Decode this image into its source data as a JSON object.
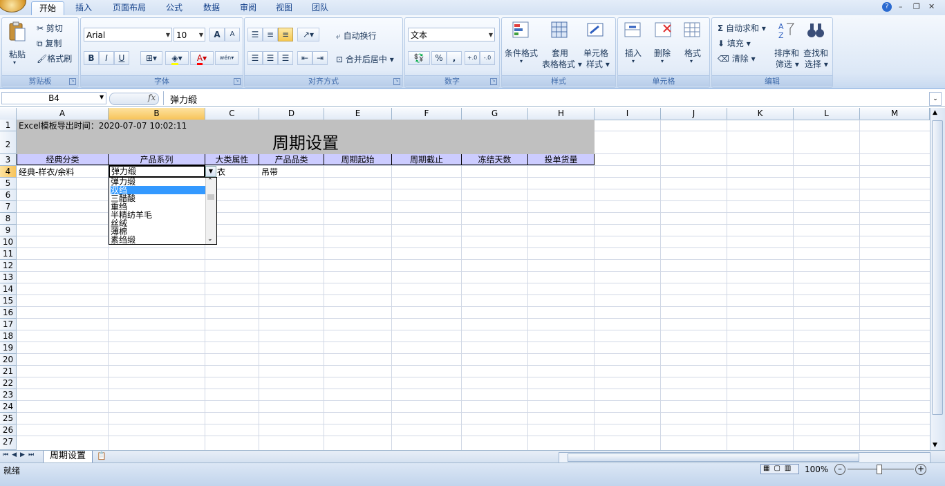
{
  "tabs": [
    "开始",
    "插入",
    "页面布局",
    "公式",
    "数据",
    "审阅",
    "视图",
    "团队"
  ],
  "active_tab": "开始",
  "clipboard": {
    "paste": "粘贴",
    "cut": "剪切",
    "copy": "复制",
    "format_painter": "格式刷",
    "label": "剪贴板"
  },
  "font": {
    "name": "Arial",
    "size": "10",
    "label": "字体",
    "grow": "A",
    "shrink": "A",
    "bold": "B",
    "italic": "I",
    "underline": "U",
    "font_color": "A",
    "phonetic": "wén"
  },
  "alignment": {
    "wrap": "自动换行",
    "merge": "合并后居中",
    "label": "对齐方式"
  },
  "number": {
    "format": "文本",
    "percent": "%",
    "comma": ",",
    "inc_dec": "+.0",
    "dec_dec": "-.0",
    "label": "数字"
  },
  "styles": {
    "conditional": "条件格式",
    "table1": "套用",
    "table2": "表格格式",
    "cell1": "单元格",
    "cell2": "样式",
    "label": "样式"
  },
  "cells": {
    "insert": "插入",
    "delete": "删除",
    "format": "格式",
    "label": "单元格"
  },
  "editing": {
    "autosum": "自动求和",
    "fill": "填充",
    "clear": "清除",
    "sort1": "排序和",
    "sort2": "筛选",
    "find1": "查找和",
    "find2": "选择",
    "label": "编辑"
  },
  "formula_bar": {
    "name_box": "B4",
    "fx": "fx",
    "value": "弹力缎"
  },
  "columns": [
    "A",
    "B",
    "C",
    "D",
    "E",
    "F",
    "G",
    "H",
    "I",
    "J",
    "K",
    "L",
    "M"
  ],
  "selected_column": "B",
  "rows": [
    "1",
    "2",
    "3",
    "4",
    "5",
    "6",
    "7",
    "8",
    "9",
    "10",
    "11",
    "12",
    "13",
    "14",
    "15",
    "16",
    "17",
    "18",
    "19",
    "20",
    "21",
    "22",
    "23",
    "24",
    "25",
    "26",
    "27"
  ],
  "selected_row": "4",
  "sheet": {
    "export_time": "Excel模板导出时间：2020-07-07 10:02:11",
    "title": "周期设置",
    "headers": [
      "经典分类",
      "产品系列",
      "大类属性",
      "产品品类",
      "周期起始",
      "周期截止",
      "冻结天数",
      "投单货量"
    ],
    "row4": {
      "a": "经典-样衣/余料",
      "b": "弹力缎",
      "c": "衣",
      "d": "吊带"
    }
  },
  "dropdown": {
    "items": [
      "弹力缎",
      "双绉",
      "三醋酸",
      "重绉",
      "半精纺羊毛",
      "丝绒",
      "薄棉",
      "素绉缎"
    ],
    "selected": "双绉"
  },
  "sheet_tab": "周期设置",
  "status": {
    "ready": "就绪",
    "zoom": "100%"
  },
  "colors": {
    "accent": "#15428b",
    "header_fill": "#ccccff",
    "title_fill": "#c0c0c0",
    "selection": "#3399ff"
  }
}
